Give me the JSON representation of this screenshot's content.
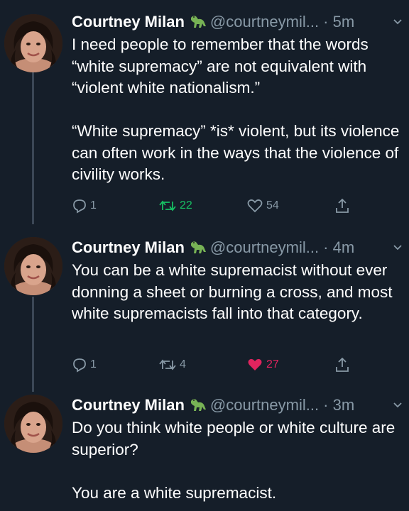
{
  "tweets": [
    {
      "name": "Courtney Milan",
      "handle": "@courtneymil...",
      "time": "5m",
      "text": "I need people to remember that the words “white supremacy” are not equivalent with “violent white nationalism.”\n\n“White supremacy” *is* violent, but its violence can often work in the ways that the violence of civility works.",
      "replies": "1",
      "retweets": "22",
      "likes": "54",
      "retweeted": true,
      "liked": false
    },
    {
      "name": "Courtney Milan",
      "handle": "@courtneymil...",
      "time": "4m",
      "text": "You can be a white supremacist without ever donning a sheet or burning a cross, and most white supremacists fall into that category.",
      "replies": "1",
      "retweets": "4",
      "likes": "27",
      "retweeted": false,
      "liked": true
    },
    {
      "name": "Courtney Milan",
      "handle": "@courtneymil...",
      "time": "3m",
      "text": "Do you think white people or white culture are superior?\n\nYou are a white supremacist."
    }
  ],
  "icons": {
    "emoji": "t-rex-emoji-icon",
    "reply": "reply-icon",
    "retweet": "retweet-icon",
    "like": "heart-icon",
    "share": "share-icon",
    "chevron": "chevron-down-icon"
  },
  "colors": {
    "background": "#151e29",
    "secondary_text": "#8899a6",
    "retweet_active": "#17bf63",
    "like_active": "#e0245e",
    "thread_line": "#3b4756"
  }
}
